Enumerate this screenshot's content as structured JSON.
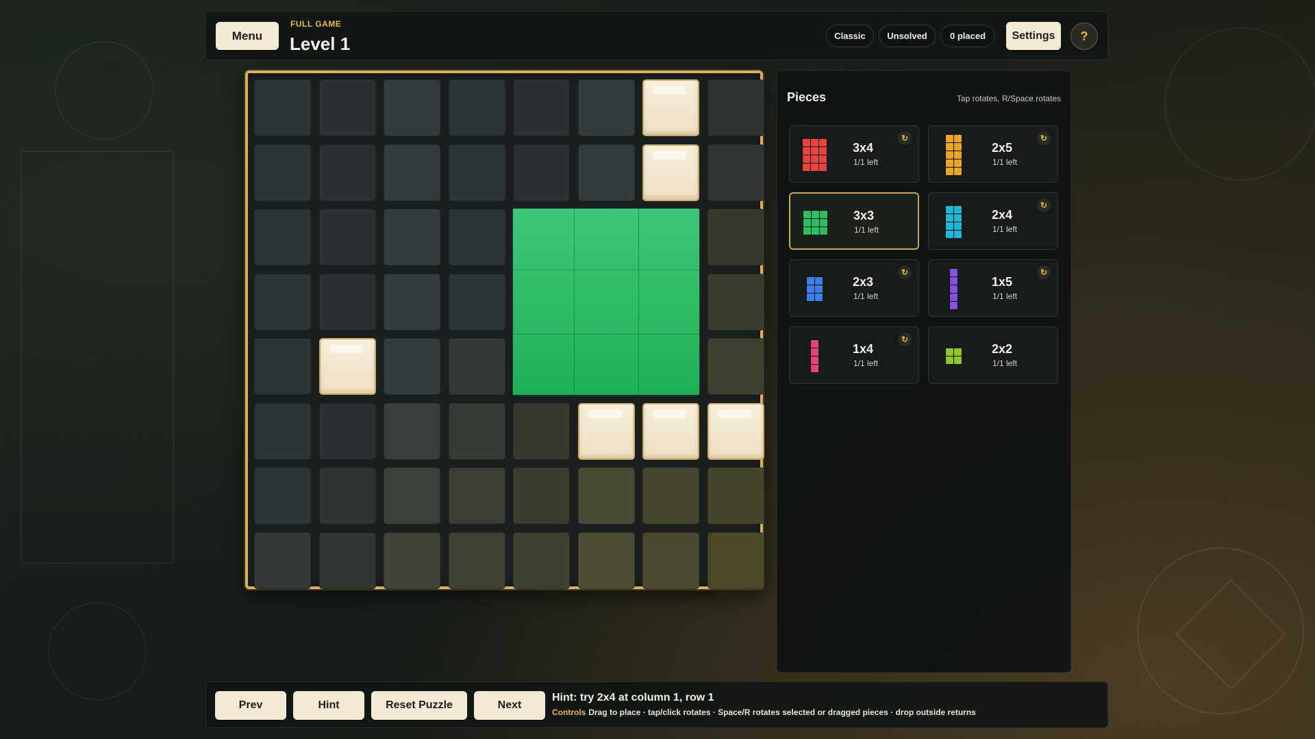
{
  "header": {
    "menu_label": "Menu",
    "game_mode": "FULL GAME",
    "level_title": "Level 1",
    "mode_pill": "Classic",
    "status_pill": "Unsolved",
    "placed_pill": "0 placed",
    "settings_label": "Settings",
    "help_label": "?"
  },
  "board": {
    "rows": 8,
    "cols": 8,
    "colors": {
      "frame": "#d8b15c",
      "block": "#f3ead6",
      "placed_piece": "#2ebd65"
    },
    "blocked_cells": [
      {
        "row": 1,
        "col": 7
      },
      {
        "row": 2,
        "col": 7
      },
      {
        "row": 5,
        "col": 2
      },
      {
        "row": 6,
        "col": 6
      },
      {
        "row": 6,
        "col": 7
      },
      {
        "row": 6,
        "col": 8
      }
    ],
    "placed_pieces": [
      {
        "name": "3x3",
        "row": 3,
        "col": 5,
        "rows": 3,
        "cols": 3,
        "color": "#2ebd65"
      }
    ]
  },
  "pieces_panel": {
    "title": "Pieces",
    "hint": "Tap rotates, R/Space rotates",
    "pieces": [
      {
        "name": "3x4",
        "count": "1/1 left",
        "color": "#e8433f",
        "rows": 4,
        "cols": 3,
        "rotatable": true,
        "selected": false
      },
      {
        "name": "2x5",
        "count": "1/1 left",
        "color": "#e9a526",
        "rows": 5,
        "cols": 2,
        "rotatable": true,
        "selected": false
      },
      {
        "name": "3x3",
        "count": "1/1 left",
        "color": "#2fbf62",
        "rows": 3,
        "cols": 3,
        "rotatable": false,
        "selected": true
      },
      {
        "name": "2x4",
        "count": "1/1 left",
        "color": "#20b8d6",
        "rows": 4,
        "cols": 2,
        "rotatable": true,
        "selected": false
      },
      {
        "name": "2x3",
        "count": "1/1 left",
        "color": "#3d7fe8",
        "rows": 3,
        "cols": 2,
        "rotatable": true,
        "selected": false
      },
      {
        "name": "1x5",
        "count": "1/1 left",
        "color": "#8a4fe0",
        "rows": 5,
        "cols": 1,
        "rotatable": true,
        "selected": false
      },
      {
        "name": "1x4",
        "count": "1/1 left",
        "color": "#e8427e",
        "rows": 4,
        "cols": 1,
        "rotatable": true,
        "selected": false
      },
      {
        "name": "2x2",
        "count": "1/1 left",
        "color": "#8ac926",
        "rows": 2,
        "cols": 2,
        "rotatable": false,
        "selected": false
      }
    ]
  },
  "footer": {
    "prev_label": "Prev",
    "hint_label": "Hint",
    "reset_label": "Reset Puzzle",
    "next_label": "Next",
    "hint_text": "Hint: try 2x4 at column 1, row 1",
    "controls_label": "Controls",
    "controls_text": "Drag to place · tap/click rotates · Space/R rotates selected or dragged pieces · drop outside returns"
  }
}
